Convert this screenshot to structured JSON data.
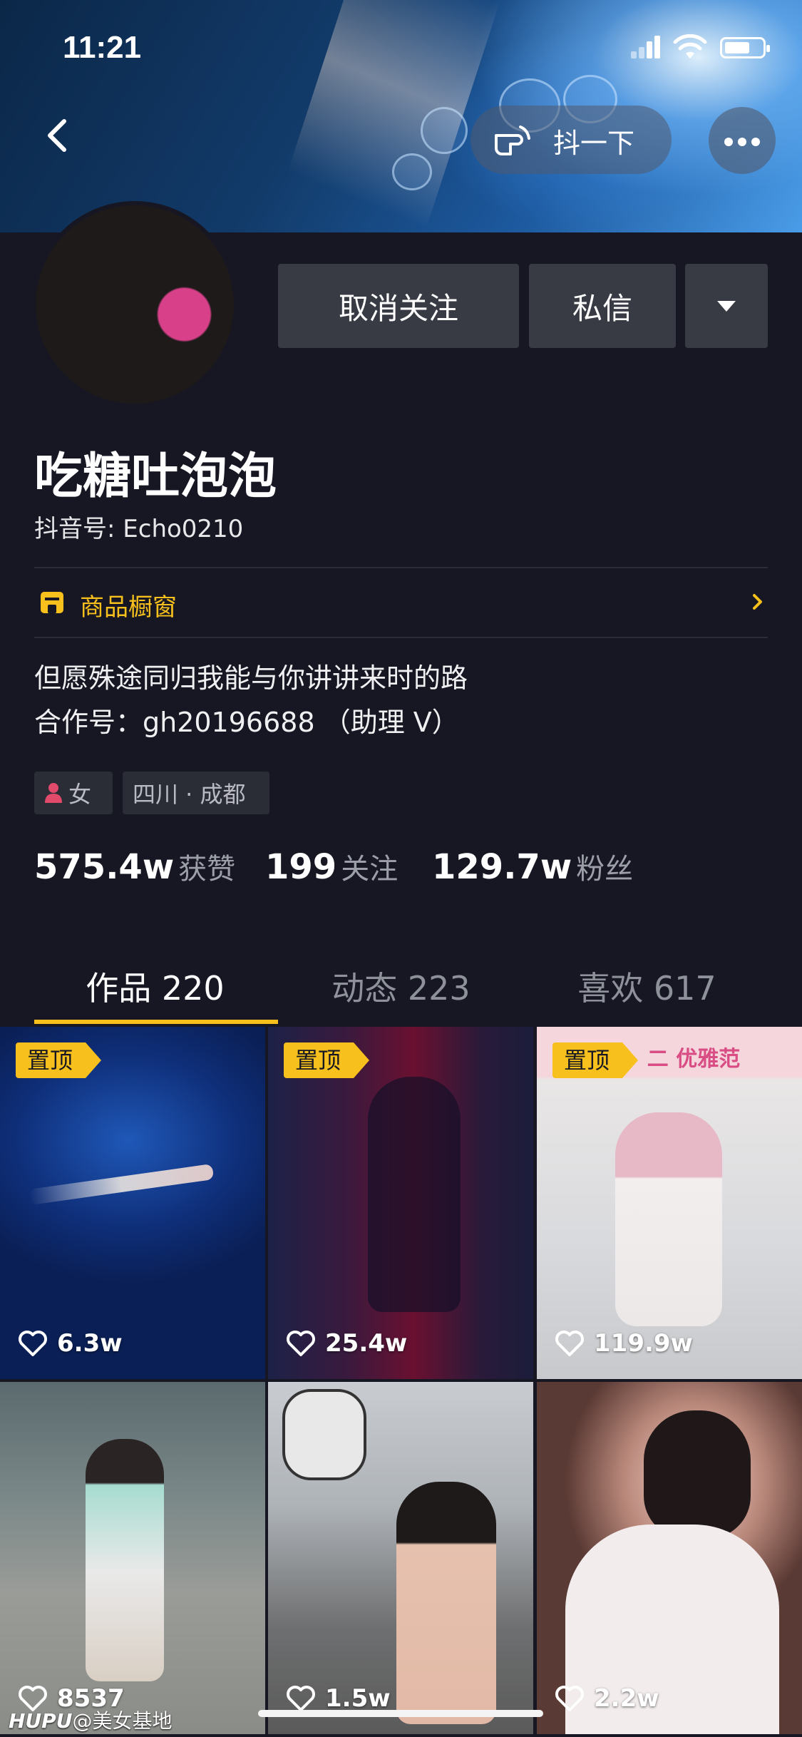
{
  "status_bar": {
    "time": "11:21"
  },
  "nav": {
    "shake_label": "抖一下"
  },
  "actions": {
    "unfollow_label": "取消关注",
    "message_label": "私信"
  },
  "profile": {
    "name": "吃糖吐泡泡",
    "douyin_id": "抖音号: Echo0210",
    "shop_label": "商品橱窗",
    "bio_line1": "但愿殊途同归我能与你讲讲来时的路",
    "bio_line2": "合作号：gh20196688 （助理 V）",
    "gender": "女",
    "location": "四川 · 成都"
  },
  "stats": [
    {
      "value": "575.4w",
      "label": "获赞"
    },
    {
      "value": "199",
      "label": "关注"
    },
    {
      "value": "129.7w",
      "label": "粉丝"
    }
  ],
  "tabs": [
    {
      "label": "作品 220",
      "active": true
    },
    {
      "label": "动态 223",
      "active": false
    },
    {
      "label": "喜欢 617",
      "active": false
    }
  ],
  "videos": [
    {
      "pinned_label": "置顶",
      "likes": "6.3w"
    },
    {
      "pinned_label": "置顶",
      "likes": "25.4w"
    },
    {
      "pinned_label": "置顶",
      "likes": "119.9w",
      "overlay_text": "二 优雅范"
    },
    {
      "likes": "8537"
    },
    {
      "likes": "1.5w"
    },
    {
      "likes": "2.2w"
    }
  ],
  "watermark": {
    "brand": "HUPU",
    "handle": "@美女基地"
  },
  "colors": {
    "accent": "#f7c01c",
    "background": "#161722",
    "button": "#393b44"
  }
}
